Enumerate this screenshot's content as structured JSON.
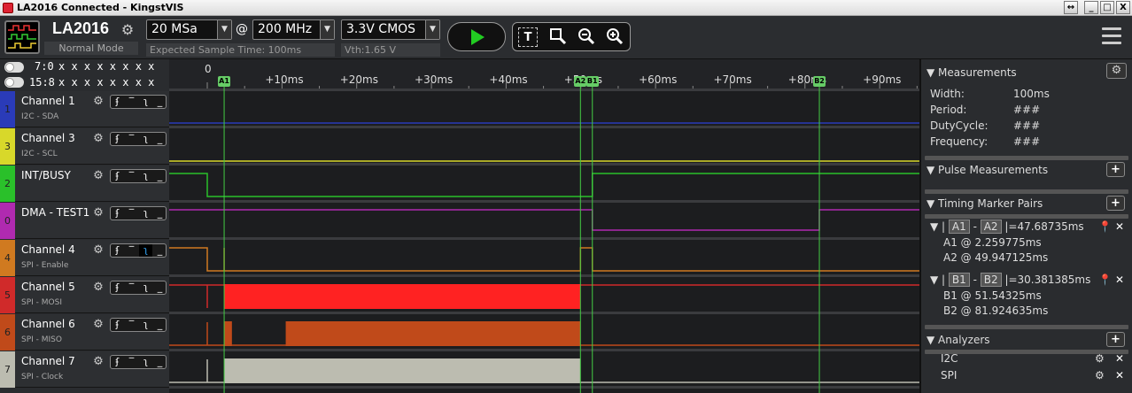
{
  "window": {
    "title": "LA2016 Connected - KingstVIS",
    "btn_resize": "↔",
    "btn_min": "_",
    "btn_max": "□",
    "btn_close": "X"
  },
  "device": {
    "name": "LA2016",
    "mode": "Normal Mode"
  },
  "sampling": {
    "rate": "20 MSa",
    "at": "@",
    "freq": "200 MHz",
    "voltage": "3.3V CMOS",
    "expected": "Expected Sample Time: 100ms",
    "vth": "Vth:1.65 V"
  },
  "tools": {
    "text": "T",
    "zoom_fit": "🔍",
    "zoom_out": "−",
    "zoom_in": "+"
  },
  "bus": {
    "row1_label": "7:0",
    "row1_vals": "x x x x x x x x",
    "row2_label": "15:8",
    "row2_vals": "x x x x x x x x"
  },
  "channels": [
    {
      "num": "1",
      "name": "Channel 1",
      "sub": "I2C - SDA",
      "color": "#2a3bb8"
    },
    {
      "num": "3",
      "name": "Channel 3",
      "sub": "I2C - SCL",
      "color": "#d8d82a"
    },
    {
      "num": "2",
      "name": "INT/BUSY",
      "sub": "",
      "color": "#2ac02a"
    },
    {
      "num": "0",
      "name": "DMA - TEST1",
      "sub": "",
      "color": "#b02ab0"
    },
    {
      "num": "4",
      "name": "Channel 4",
      "sub": "SPI - Enable",
      "color": "#d07a20"
    },
    {
      "num": "5",
      "name": "Channel 5",
      "sub": "SPI - MOSI",
      "color": "#d02a2a"
    },
    {
      "num": "6",
      "name": "Channel 6",
      "sub": "SPI - MISO",
      "color": "#c04a1a"
    },
    {
      "num": "7",
      "name": "Channel 7",
      "sub": "SPI - Clock",
      "color": "#bcbcb0"
    }
  ],
  "trigger_glyphs": [
    "ʄ",
    "‾",
    "ʅ",
    "_"
  ],
  "ruler": {
    "ticks": [
      "0",
      "+10ms",
      "+20ms",
      "+30ms",
      "+40ms",
      "+50ms",
      "+60ms",
      "+70ms",
      "+80ms",
      "+90ms"
    ],
    "tick_ms": [
      0,
      10,
      20,
      30,
      40,
      50,
      60,
      70,
      80,
      90
    ]
  },
  "markers": [
    {
      "label": "A1",
      "ms": 2.259775
    },
    {
      "label": "A2",
      "ms": 49.947125
    },
    {
      "label": "B1",
      "ms": 51.54325
    },
    {
      "label": "B2",
      "ms": 81.924635
    }
  ],
  "panel": {
    "measurements": {
      "title": "Measurements",
      "rows": [
        {
          "k": "Width:",
          "v": "100ms"
        },
        {
          "k": "Period:",
          "v": "###"
        },
        {
          "k": "DutyCycle:",
          "v": "###"
        },
        {
          "k": "Frequency:",
          "v": "###"
        }
      ]
    },
    "pulse": {
      "title": "Pulse Measurements"
    },
    "timing": {
      "title": "Timing Marker Pairs",
      "pairs": [
        {
          "a": "A1",
          "b": "A2",
          "delta": "=47.68735ms",
          "l1": "A1 @ 2.259775ms",
          "l2": "A2 @ 49.947125ms"
        },
        {
          "a": "B1",
          "b": "B2",
          "delta": "=30.381385ms",
          "l1": "B1 @ 51.54325ms",
          "l2": "B2 @ 81.924635ms"
        }
      ]
    },
    "analyzers": {
      "title": "Analyzers",
      "items": [
        "I2C",
        "SPI"
      ]
    }
  }
}
